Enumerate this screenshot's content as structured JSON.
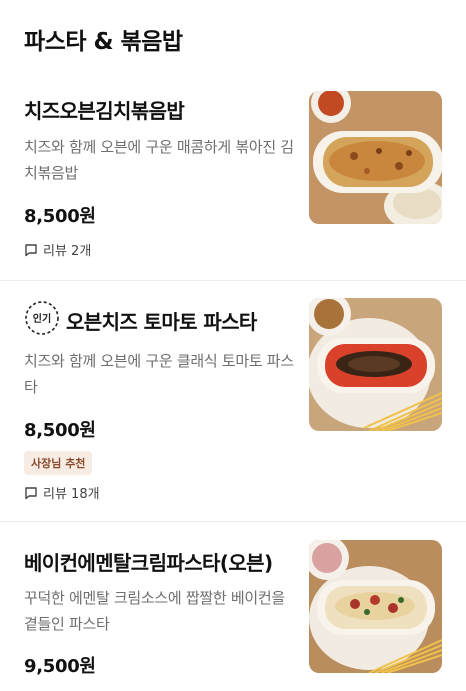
{
  "section": {
    "title": "파스타 & 볶음밥"
  },
  "items": [
    {
      "name": "치즈오븐김치볶음밥",
      "description": "치즈와 함께 오븐에 구운 매콤하게 볶아진 김치볶음밥",
      "price": "8,500원",
      "review": "리뷰 2개",
      "image_icon": "kimchi-fried-rice-photo"
    },
    {
      "name": "오븐치즈 토마토 파스타",
      "popular_label": "인기",
      "description": "치즈와 함께 오븐에 구운 클래식 토마토 파스타",
      "price": "8,500원",
      "badge": "사장님 추천",
      "review": "리뷰 18개",
      "image_icon": "tomato-pasta-photo"
    },
    {
      "name": "베이컨에멘탈크림파스타(오븐)",
      "description": "꾸덕한 에멘탈 크림소스에 짭짤한 베이컨을 곁들인 파스타",
      "price": "9,500원",
      "image_icon": "cream-pasta-photo"
    }
  ],
  "colors": {
    "text_primary": "#111111",
    "text_secondary": "#6f6f6f",
    "badge_bg": "#f7ece4",
    "badge_text": "#8a4b2a",
    "divider": "#ececec"
  }
}
